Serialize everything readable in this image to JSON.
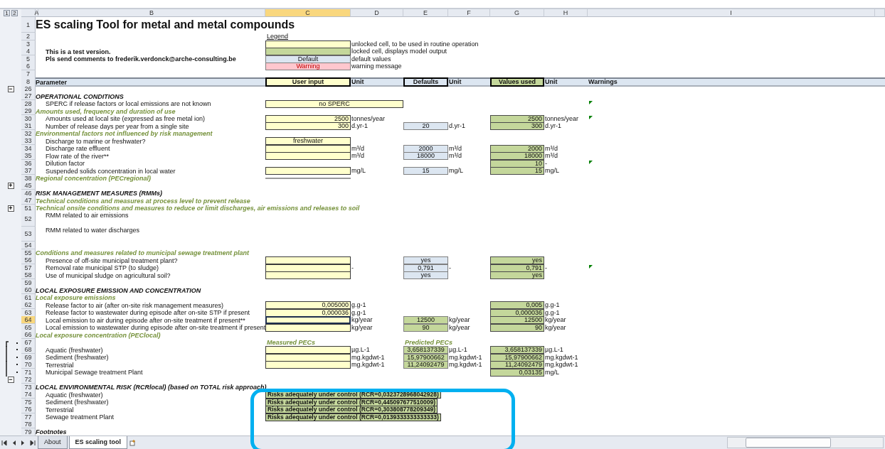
{
  "outline_levels": [
    "1",
    "2"
  ],
  "columns": [
    {
      "label": "A",
      "selected": false
    },
    {
      "label": "B",
      "selected": false
    },
    {
      "label": "C",
      "selected": true
    },
    {
      "label": "D",
      "selected": false
    },
    {
      "label": "E",
      "selected": false
    },
    {
      "label": "F",
      "selected": false
    },
    {
      "label": "G",
      "selected": false
    },
    {
      "label": "H",
      "selected": false
    },
    {
      "label": "I",
      "selected": false
    }
  ],
  "rows": [
    {
      "num": "1",
      "selected": false,
      "kind": "title",
      "label": "ES scaling Tool for metal and metal compounds"
    },
    {
      "num": "2",
      "selected": false,
      "kind": "blank",
      "c": {
        "kind": "underlined",
        "value": "Legend"
      }
    },
    {
      "num": "3",
      "selected": false,
      "kind": "blank",
      "c": {
        "kind": "input"
      },
      "d": {
        "kind": "text",
        "value": "unlocked cell, to be used in routine operation"
      }
    },
    {
      "num": "4",
      "selected": false,
      "kind": "note",
      "label": "This is a test version.",
      "c": {
        "kind": "output"
      },
      "d": {
        "kind": "text",
        "value": "locked cell, displays model output"
      }
    },
    {
      "num": "5",
      "selected": false,
      "kind": "note",
      "label": "Pls send comments to frederik.verdonck@arche-consulting.be",
      "c": {
        "kind": "default",
        "value": "Default"
      },
      "d": {
        "kind": "text",
        "value": "default values"
      }
    },
    {
      "num": "6",
      "selected": false,
      "kind": "blank",
      "c": {
        "kind": "warning",
        "value": "Warning"
      },
      "d": {
        "kind": "text",
        "value": "warning message"
      }
    },
    {
      "num": "7",
      "selected": false,
      "kind": "blank"
    },
    {
      "num": "8",
      "selected": false,
      "kind": "header",
      "label": "Parameter",
      "c": {
        "kind": "header_input",
        "value": "User input"
      },
      "d": {
        "kind": "header_text",
        "value": "Unit"
      },
      "e": {
        "kind": "header_default",
        "value": "Defaults"
      },
      "f": {
        "kind": "header_text",
        "value": "Unit"
      },
      "g": {
        "kind": "header_output",
        "value": "Values used"
      },
      "h": {
        "kind": "header_text",
        "value": "Unit"
      },
      "i": {
        "kind": "header_text",
        "value": "Warnings"
      }
    },
    {
      "num": "26",
      "selected": false,
      "kind": "blank",
      "outline": {
        "kind": "collapse",
        "symbol": "−"
      }
    },
    {
      "num": "27",
      "selected": false,
      "kind": "section",
      "label": "OPERATIONAL CONDITIONS"
    },
    {
      "num": "28",
      "selected": false,
      "kind": "item",
      "label": "SPERC  if release factors or local emissions are not known",
      "c": {
        "kind": "input_wide",
        "value": "no SPERC"
      },
      "flag": true
    },
    {
      "num": "29",
      "selected": false,
      "kind": "subsection",
      "label": "Amounts used, frequency and duration of use"
    },
    {
      "num": "30",
      "selected": false,
      "kind": "item",
      "label": "Amounts used at local site (expressed as free metal ion)",
      "c": {
        "kind": "input",
        "value": "2500"
      },
      "d": {
        "kind": "text",
        "value": "tonnes/year"
      },
      "g": {
        "kind": "output",
        "value": "2500"
      },
      "h": {
        "kind": "text",
        "value": "tonnes/year"
      },
      "flag": true
    },
    {
      "num": "31",
      "selected": false,
      "kind": "item",
      "label": "Number of release days per year from a single site",
      "c": {
        "kind": "input",
        "value": "300"
      },
      "d": {
        "kind": "text",
        "value": "d.yr-1"
      },
      "e": {
        "kind": "default",
        "value": "20"
      },
      "f": {
        "kind": "text",
        "value": "d.yr-1"
      },
      "g": {
        "kind": "output",
        "value": "300"
      },
      "h": {
        "kind": "text",
        "value": "d.yr-1"
      }
    },
    {
      "num": "32",
      "selected": false,
      "kind": "subsection",
      "label": "Environmental factors not influenced by risk management"
    },
    {
      "num": "33",
      "selected": false,
      "kind": "item",
      "label": "Discharge to marine or freshwater?",
      "c": {
        "kind": "input_choice",
        "value": "freshwater"
      }
    },
    {
      "num": "34",
      "selected": false,
      "kind": "item",
      "label": "Discharge rate effluent",
      "c": {
        "kind": "input"
      },
      "d": {
        "kind": "text",
        "value": "m³/d"
      },
      "e": {
        "kind": "default",
        "value": "2000"
      },
      "f": {
        "kind": "text",
        "value": "m³/d"
      },
      "g": {
        "kind": "output",
        "value": "2000"
      },
      "h": {
        "kind": "text",
        "value": "m³/d"
      }
    },
    {
      "num": "35",
      "selected": false,
      "kind": "item",
      "label": "Flow rate of the river**",
      "c": {
        "kind": "input"
      },
      "d": {
        "kind": "text",
        "value": "m³/d"
      },
      "e": {
        "kind": "default",
        "value": "18000"
      },
      "f": {
        "kind": "text",
        "value": "m³/d"
      },
      "g": {
        "kind": "output",
        "value": "18000"
      },
      "h": {
        "kind": "text",
        "value": "m³/d"
      }
    },
    {
      "num": "36",
      "selected": false,
      "kind": "item",
      "label": "Dilution factor",
      "g": {
        "kind": "output",
        "value": "10"
      },
      "h": {
        "kind": "text",
        "value": "-"
      },
      "flag": true
    },
    {
      "num": "37",
      "selected": false,
      "kind": "item",
      "label": "Suspended solids concentration in local water",
      "c": {
        "kind": "input"
      },
      "d": {
        "kind": "text",
        "value": "mg/L"
      },
      "e": {
        "kind": "default",
        "value": "15"
      },
      "f": {
        "kind": "text",
        "value": "mg/L"
      },
      "g": {
        "kind": "output",
        "value": "15"
      },
      "h": {
        "kind": "text",
        "value": "mg/L"
      }
    },
    {
      "num": "38",
      "selected": false,
      "kind": "subsection",
      "label": "Regional concentration (PECregional)",
      "c": {
        "kind": "rule"
      }
    },
    {
      "num": "45",
      "selected": false,
      "kind": "blank",
      "outline": {
        "kind": "expand",
        "symbol": "+"
      }
    },
    {
      "num": "46",
      "selected": false,
      "kind": "section",
      "label": "RISK MANAGEMENT MEASURES (RMMs)"
    },
    {
      "num": "47",
      "selected": false,
      "kind": "subsection",
      "label": "Technical conditions and measures at process level to prevent release"
    },
    {
      "num": "51",
      "selected": false,
      "kind": "subsection",
      "label": "Technical onsite conditions and measures to reduce or limit discharges, air emissions and releases to soil",
      "outline": {
        "kind": "expand",
        "symbol": "+"
      }
    },
    {
      "num": "52",
      "selected": false,
      "kind": "item_tall",
      "label": "RMM related to air emissions"
    },
    {
      "num": "53",
      "selected": false,
      "kind": "item_tall",
      "label": "RMM related to water discharges"
    },
    {
      "num": "54",
      "selected": false,
      "kind": "blank"
    },
    {
      "num": "55",
      "selected": false,
      "kind": "subsection",
      "label": "Conditions and measures related to municipal sewage treatment plant"
    },
    {
      "num": "56",
      "selected": false,
      "kind": "item",
      "label": "Presence of off-site municipal treatment plant?",
      "c": {
        "kind": "input"
      },
      "e": {
        "kind": "default",
        "value": "yes"
      },
      "g": {
        "kind": "output",
        "value": "yes"
      }
    },
    {
      "num": "57",
      "selected": false,
      "kind": "item",
      "label": "Removal rate municipal STP (to sludge)",
      "c": {
        "kind": "input"
      },
      "d": {
        "kind": "text",
        "value": "-"
      },
      "e": {
        "kind": "default",
        "value": "0,791"
      },
      "f": {
        "kind": "text",
        "value": "-"
      },
      "g": {
        "kind": "output",
        "value": "0,791"
      },
      "h": {
        "kind": "text",
        "value": "-"
      },
      "flag": true
    },
    {
      "num": "58",
      "selected": false,
      "kind": "item",
      "label": "Use of municipal sludge on agricultural soil?",
      "c": {
        "kind": "input"
      },
      "e": {
        "kind": "default",
        "value": "yes"
      },
      "g": {
        "kind": "output",
        "value": "yes"
      }
    },
    {
      "num": "59",
      "selected": false,
      "kind": "blank"
    },
    {
      "num": "60",
      "selected": false,
      "kind": "section",
      "label": "LOCAL EXPOSURE EMISSION AND CONCENTRATION"
    },
    {
      "num": "61",
      "selected": false,
      "kind": "subsection",
      "label": "Local exposure emissions"
    },
    {
      "num": "62",
      "selected": false,
      "kind": "item",
      "label": "Release factor to air (after on-site risk management measures)",
      "c": {
        "kind": "input",
        "value": "0,005000"
      },
      "d": {
        "kind": "text",
        "value": "g.g-1"
      },
      "g": {
        "kind": "output",
        "value": "0,005"
      },
      "h": {
        "kind": "text",
        "value": "g.g-1"
      }
    },
    {
      "num": "63",
      "selected": false,
      "kind": "item",
      "label": "Release factor to wastewater during episode after on-site STP if present",
      "c": {
        "kind": "input",
        "value": "0,000036"
      },
      "d": {
        "kind": "text",
        "value": "g.g-1"
      },
      "g": {
        "kind": "output",
        "value": "0,000036"
      },
      "h": {
        "kind": "text",
        "value": "g.g-1"
      }
    },
    {
      "num": "64",
      "selected": true,
      "kind": "item",
      "label": "Local emission to air during episode after on-site treatment if present**",
      "c": {
        "kind": "input"
      },
      "d": {
        "kind": "text",
        "value": "kg/year"
      },
      "e": {
        "kind": "computed",
        "value": "12500"
      },
      "f": {
        "kind": "text",
        "value": "kg/year"
      },
      "g": {
        "kind": "output",
        "value": "12500"
      },
      "h": {
        "kind": "text",
        "value": "kg/year"
      }
    },
    {
      "num": "65",
      "selected": false,
      "kind": "item",
      "label": "Local emission to wastewater during episode after on-site treatment if present",
      "c": {
        "kind": "input"
      },
      "d": {
        "kind": "text",
        "value": "kg/year"
      },
      "e": {
        "kind": "computed",
        "value": "90"
      },
      "f": {
        "kind": "text",
        "value": "kg/year"
      },
      "g": {
        "kind": "output",
        "value": "90"
      },
      "h": {
        "kind": "text",
        "value": "kg/year"
      }
    },
    {
      "num": "66",
      "selected": false,
      "kind": "subsection",
      "label": "Local exposure concentration (PEClocal)"
    },
    {
      "num": "67",
      "selected": false,
      "kind": "blank",
      "c": {
        "kind": "caption",
        "value": "Measured PECs"
      },
      "e": {
        "kind": "caption",
        "value": "Predicted PECs"
      },
      "outline": {
        "kind": "bracket_start"
      }
    },
    {
      "num": "68",
      "selected": false,
      "kind": "item",
      "label": "Aquatic (freshwater)",
      "c": {
        "kind": "input"
      },
      "d": {
        "kind": "text",
        "value": "µg.L-1"
      },
      "e": {
        "kind": "computed",
        "value": "3,658137339"
      },
      "f": {
        "kind": "text",
        "value": "µg.L-1"
      },
      "g": {
        "kind": "output",
        "value": "3,658137339"
      },
      "h": {
        "kind": "text",
        "value": "µg.L-1"
      },
      "outline": {
        "kind": "dot"
      }
    },
    {
      "num": "69",
      "selected": false,
      "kind": "item",
      "label": "Sediment (freshwater)",
      "c": {
        "kind": "input"
      },
      "d": {
        "kind": "text",
        "value": "mg.kgdwt-1"
      },
      "e": {
        "kind": "computed",
        "value": "15,97900662"
      },
      "f": {
        "kind": "text",
        "value": "mg.kgdwt-1"
      },
      "g": {
        "kind": "output",
        "value": "15,97900662"
      },
      "h": {
        "kind": "text",
        "value": "mg.kgdwt-1"
      },
      "outline": {
        "kind": "dot"
      }
    },
    {
      "num": "70",
      "selected": false,
      "kind": "item",
      "label": "Terrestrial",
      "c": {
        "kind": "input"
      },
      "d": {
        "kind": "text",
        "value": "mg.kgdwt-1"
      },
      "e": {
        "kind": "computed",
        "value": "11,24092479"
      },
      "f": {
        "kind": "text",
        "value": "mg.kgdwt-1"
      },
      "g": {
        "kind": "output",
        "value": "11,24092479"
      },
      "h": {
        "kind": "text",
        "value": "mg.kgdwt-1"
      },
      "outline": {
        "kind": "dot"
      }
    },
    {
      "num": "71",
      "selected": false,
      "kind": "item",
      "label": "Municipal Sewage treatment Plant",
      "g": {
        "kind": "output",
        "value": "0,03135"
      },
      "h": {
        "kind": "text",
        "value": "mg/L"
      },
      "outline": {
        "kind": "dot"
      }
    },
    {
      "num": "72",
      "selected": false,
      "kind": "blank",
      "outline": {
        "kind": "bracket_end",
        "symbol": "−"
      }
    },
    {
      "num": "73",
      "selected": false,
      "kind": "section",
      "label": "LOCAL ENVIRONMENTAL RISK (RCRlocal) (based on TOTAL risk approach)"
    },
    {
      "num": "74",
      "selected": false,
      "kind": "item",
      "label": "Aquatic (freshwater)",
      "c": {
        "kind": "risk",
        "value": "Risks adequately under control (RCR=0,0323728968042928)"
      },
      "highlight_frame": true
    },
    {
      "num": "75",
      "selected": false,
      "kind": "item",
      "label": "Sediment (freshwater)",
      "c": {
        "kind": "risk",
        "value": "Risks adequately under control (RCR=0,445097677510009)"
      }
    },
    {
      "num": "76",
      "selected": false,
      "kind": "item",
      "label": "Terrestrial",
      "c": {
        "kind": "risk",
        "value": "Risks adequately under control (RCR=0,303808778209349)"
      }
    },
    {
      "num": "77",
      "selected": false,
      "kind": "item",
      "label": "Sewage treatment Plant",
      "c": {
        "kind": "risk",
        "value": "Risks adequately under control (RCR=0,0139333333333333)"
      }
    },
    {
      "num": "78",
      "selected": false,
      "kind": "blank"
    },
    {
      "num": "79",
      "selected": false,
      "kind": "section",
      "label": "Footnotes"
    }
  ],
  "sheet_tabs": [
    {
      "label": "About",
      "selected": false
    },
    {
      "label": "ES scaling tool",
      "selected": true
    }
  ]
}
